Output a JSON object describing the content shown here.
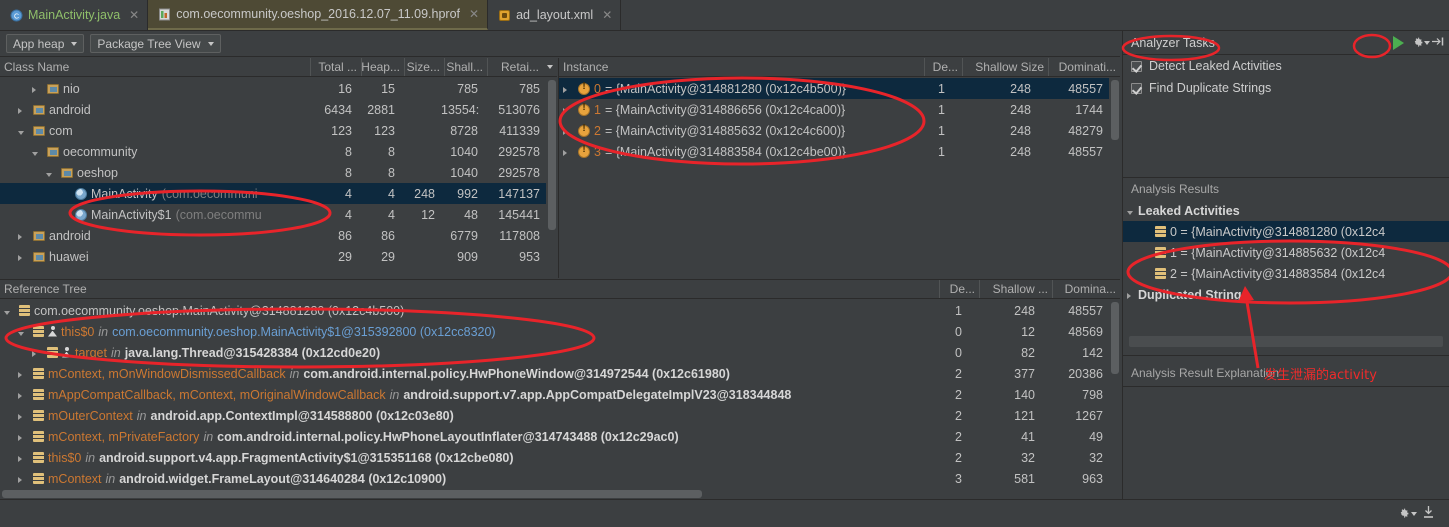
{
  "tabs": [
    {
      "label": "MainActivity.java",
      "icon": "java-class-icon",
      "state": "normal",
      "closeable": true
    },
    {
      "label": "com.oecommunity.oeshop_2016.12.07_11.09.hprof",
      "icon": "hprof-file-icon",
      "state": "selected",
      "closeable": true
    },
    {
      "label": "ad_layout.xml",
      "icon": "xml-file-icon",
      "state": "normal",
      "closeable": true
    }
  ],
  "toolbar": {
    "heap_selector": "App heap",
    "view_selector": "Package Tree View"
  },
  "class_panel": {
    "columns": [
      "Class Name",
      "Total ...",
      "Heap...",
      "Size...",
      "Shall...",
      "Retai..."
    ],
    "rows": [
      {
        "indent": 2,
        "twisty": "closed",
        "icon": "folder-icon",
        "name": "nio",
        "pkg": "",
        "total": "16",
        "heap": "15",
        "size": "",
        "shallow": "785",
        "retained": "785",
        "selected": false
      },
      {
        "indent": 1,
        "twisty": "closed",
        "icon": "folder-icon",
        "name": "android",
        "pkg": "",
        "total": "6434",
        "heap": "2881",
        "size": "",
        "shallow": "13554:",
        "retained": "513076",
        "selected": false
      },
      {
        "indent": 1,
        "twisty": "open",
        "icon": "folder-icon",
        "name": "com",
        "pkg": "",
        "total": "123",
        "heap": "123",
        "size": "",
        "shallow": "8728",
        "retained": "411339",
        "selected": false
      },
      {
        "indent": 2,
        "twisty": "open",
        "icon": "folder-icon",
        "name": "oecommunity",
        "pkg": "",
        "total": "8",
        "heap": "8",
        "size": "",
        "shallow": "1040",
        "retained": "292578",
        "selected": false
      },
      {
        "indent": 3,
        "twisty": "open",
        "icon": "folder-icon",
        "name": "oeshop",
        "pkg": "",
        "total": "8",
        "heap": "8",
        "size": "",
        "shallow": "1040",
        "retained": "292578",
        "selected": false
      },
      {
        "indent": 4,
        "twisty": "none",
        "icon": "class-icon",
        "name": "MainActivity",
        "pkg": "(com.oecommuni",
        "total": "4",
        "heap": "4",
        "size": "248",
        "shallow": "992",
        "retained": "147137",
        "selected": true
      },
      {
        "indent": 4,
        "twisty": "none",
        "icon": "class-icon",
        "name": "MainActivity$1",
        "pkg": "(com.oecommu",
        "total": "4",
        "heap": "4",
        "size": "12",
        "shallow": "48",
        "retained": "145441",
        "selected": false
      },
      {
        "indent": 1,
        "twisty": "closed",
        "icon": "folder-icon",
        "name": "android",
        "pkg": "",
        "total": "86",
        "heap": "86",
        "size": "",
        "shallow": "6779",
        "retained": "117808",
        "selected": false
      },
      {
        "indent": 1,
        "twisty": "closed",
        "icon": "folder-icon",
        "name": "huawei",
        "pkg": "",
        "total": "29",
        "heap": "29",
        "size": "",
        "shallow": "909",
        "retained": "953",
        "selected": false
      }
    ]
  },
  "instance_panel": {
    "columns": [
      "Instance",
      "De...",
      "Shallow Size",
      "Dominati..."
    ],
    "rows": [
      {
        "index": "0",
        "text": "= {MainActivity@314881280 (0x12c4b500)}",
        "depth": "1",
        "shallow": "248",
        "dominating": "48557",
        "selected": true
      },
      {
        "index": "1",
        "text": "= {MainActivity@314886656 (0x12c4ca00)}",
        "depth": "1",
        "shallow": "248",
        "dominating": "1744",
        "selected": false
      },
      {
        "index": "2",
        "text": "= {MainActivity@314885632 (0x12c4c600)}",
        "depth": "1",
        "shallow": "248",
        "dominating": "48279",
        "selected": false
      },
      {
        "index": "3",
        "text": "= {MainActivity@314883584 (0x12c4be00)}",
        "depth": "1",
        "shallow": "248",
        "dominating": "48557",
        "selected": false
      }
    ]
  },
  "reference_tree": {
    "title": "Reference Tree",
    "columns": [
      "De...",
      "Shallow ...",
      "Domina..."
    ],
    "rows": [
      {
        "indent": 0,
        "twisty": "open",
        "field": "",
        "root": "com.oecommunity.oeshop.MainActivity@314881280 (0x12c4b500)",
        "in_target": "",
        "depth": "1",
        "shallow": "248",
        "dominating": "48557",
        "person": false
      },
      {
        "indent": 1,
        "twisty": "open",
        "field": "this$0",
        "root": "",
        "in_target": "com.oecommunity.oeshop.MainActivity$1@315392800 (0x12cc8320)",
        "depth": "0",
        "shallow": "12",
        "dominating": "48569",
        "person": true
      },
      {
        "indent": 2,
        "twisty": "closed",
        "field": "target",
        "root": "",
        "in_target": "java.lang.Thread@315428384 (0x12cd0e20)",
        "depth": "0",
        "shallow": "82",
        "dominating": "142",
        "person": true
      },
      {
        "indent": 1,
        "twisty": "closed",
        "field": "mContext, mOnWindowDismissedCallback",
        "root": "",
        "in_target": "com.android.internal.policy.HwPhoneWindow@314972544 (0x12c61980)",
        "depth": "2",
        "shallow": "377",
        "dominating": "20386",
        "person": false
      },
      {
        "indent": 1,
        "twisty": "closed",
        "field": "mAppCompatCallback, mContext, mOriginalWindowCallback",
        "root": "",
        "in_target": "android.support.v7.app.AppCompatDelegateImplV23@318344848",
        "depth": "2",
        "shallow": "140",
        "dominating": "798",
        "person": false
      },
      {
        "indent": 1,
        "twisty": "closed",
        "field": "mOuterContext",
        "root": "",
        "in_target": "android.app.ContextImpl@314588800 (0x12c03e80)",
        "depth": "2",
        "shallow": "121",
        "dominating": "1267",
        "person": false
      },
      {
        "indent": 1,
        "twisty": "closed",
        "field": "mContext, mPrivateFactory",
        "root": "",
        "in_target": "com.android.internal.policy.HwPhoneLayoutInflater@314743488 (0x12c29ac0)",
        "depth": "2",
        "shallow": "41",
        "dominating": "49",
        "person": false
      },
      {
        "indent": 1,
        "twisty": "closed",
        "field": "this$0",
        "root": "",
        "in_target": "android.support.v4.app.FragmentActivity$1@315351168 (0x12cbe080)",
        "depth": "2",
        "shallow": "32",
        "dominating": "32",
        "person": false
      },
      {
        "indent": 1,
        "twisty": "closed",
        "field": "mContext",
        "root": "",
        "in_target": "android.widget.FrameLayout@314640284 (0x12c10900)",
        "depth": "3",
        "shallow": "581",
        "dominating": "963",
        "person": false
      }
    ]
  },
  "analyzer": {
    "title": "Analyzer Tasks",
    "run_icon": "play-icon",
    "settings_icon": "gear-icon",
    "collapse_icon": "collapse-right-icon",
    "tasks": [
      {
        "label": "Detect Leaked Activities",
        "checked": true
      },
      {
        "label": "Find Duplicate Strings",
        "checked": true
      }
    ],
    "results_title": "Analysis Results",
    "groups": [
      {
        "label": "Leaked Activities",
        "expanded": true,
        "items": [
          {
            "text": "0 = {MainActivity@314881280 (0x12c4",
            "selected": true
          },
          {
            "text": "1 = {MainActivity@314885632 (0x12c4",
            "selected": false
          },
          {
            "text": "2 = {MainActivity@314883584 (0x12c4",
            "selected": false
          }
        ]
      },
      {
        "label": "Duplicated Strings",
        "expanded": false,
        "items": []
      }
    ],
    "explanation_title": "Analysis Result Explanation"
  },
  "annotation": {
    "note": "发生泄漏的activity",
    "color": "#ef2b2b"
  },
  "statusbar": {
    "settings_icon": "gear-icon",
    "download_icon": "download-icon"
  },
  "colors": {
    "background": "#3c3f41",
    "selection": "#0d293e",
    "tab_selected": "#4e4a35",
    "accent_green": "#4caf50",
    "annotation_red": "#ef2b2b",
    "identifier_orange": "#cc7832",
    "link_blue": "#6a9fd4"
  }
}
